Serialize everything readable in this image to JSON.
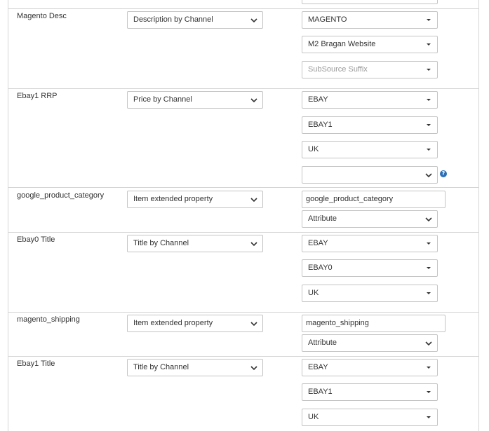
{
  "rows": [
    {
      "label": "Magento Desc",
      "source": "Description by Channel",
      "fields": [
        "MAGENTO",
        "M2 Bragan Website",
        "SubSource Suffix"
      ]
    },
    {
      "label": "Ebay1 RRP",
      "source": "Price by Channel",
      "fields": [
        "EBAY",
        "EBAY1",
        "UK",
        ""
      ]
    },
    {
      "label": "google_product_category",
      "source": "Item extended property",
      "input_value": "google_product_category",
      "type_select": "Attribute"
    },
    {
      "label": "Ebay0 Title",
      "source": "Title by Channel",
      "fields": [
        "EBAY",
        "EBAY0",
        "UK"
      ]
    },
    {
      "label": "magento_shipping",
      "source": "Item extended property",
      "input_value": "magento_shipping",
      "type_select": "Attribute"
    },
    {
      "label": "Ebay1 Title",
      "source": "Title by Channel",
      "fields": [
        "EBAY",
        "EBAY1",
        "UK"
      ]
    }
  ],
  "help_icon": "question-circle-icon"
}
